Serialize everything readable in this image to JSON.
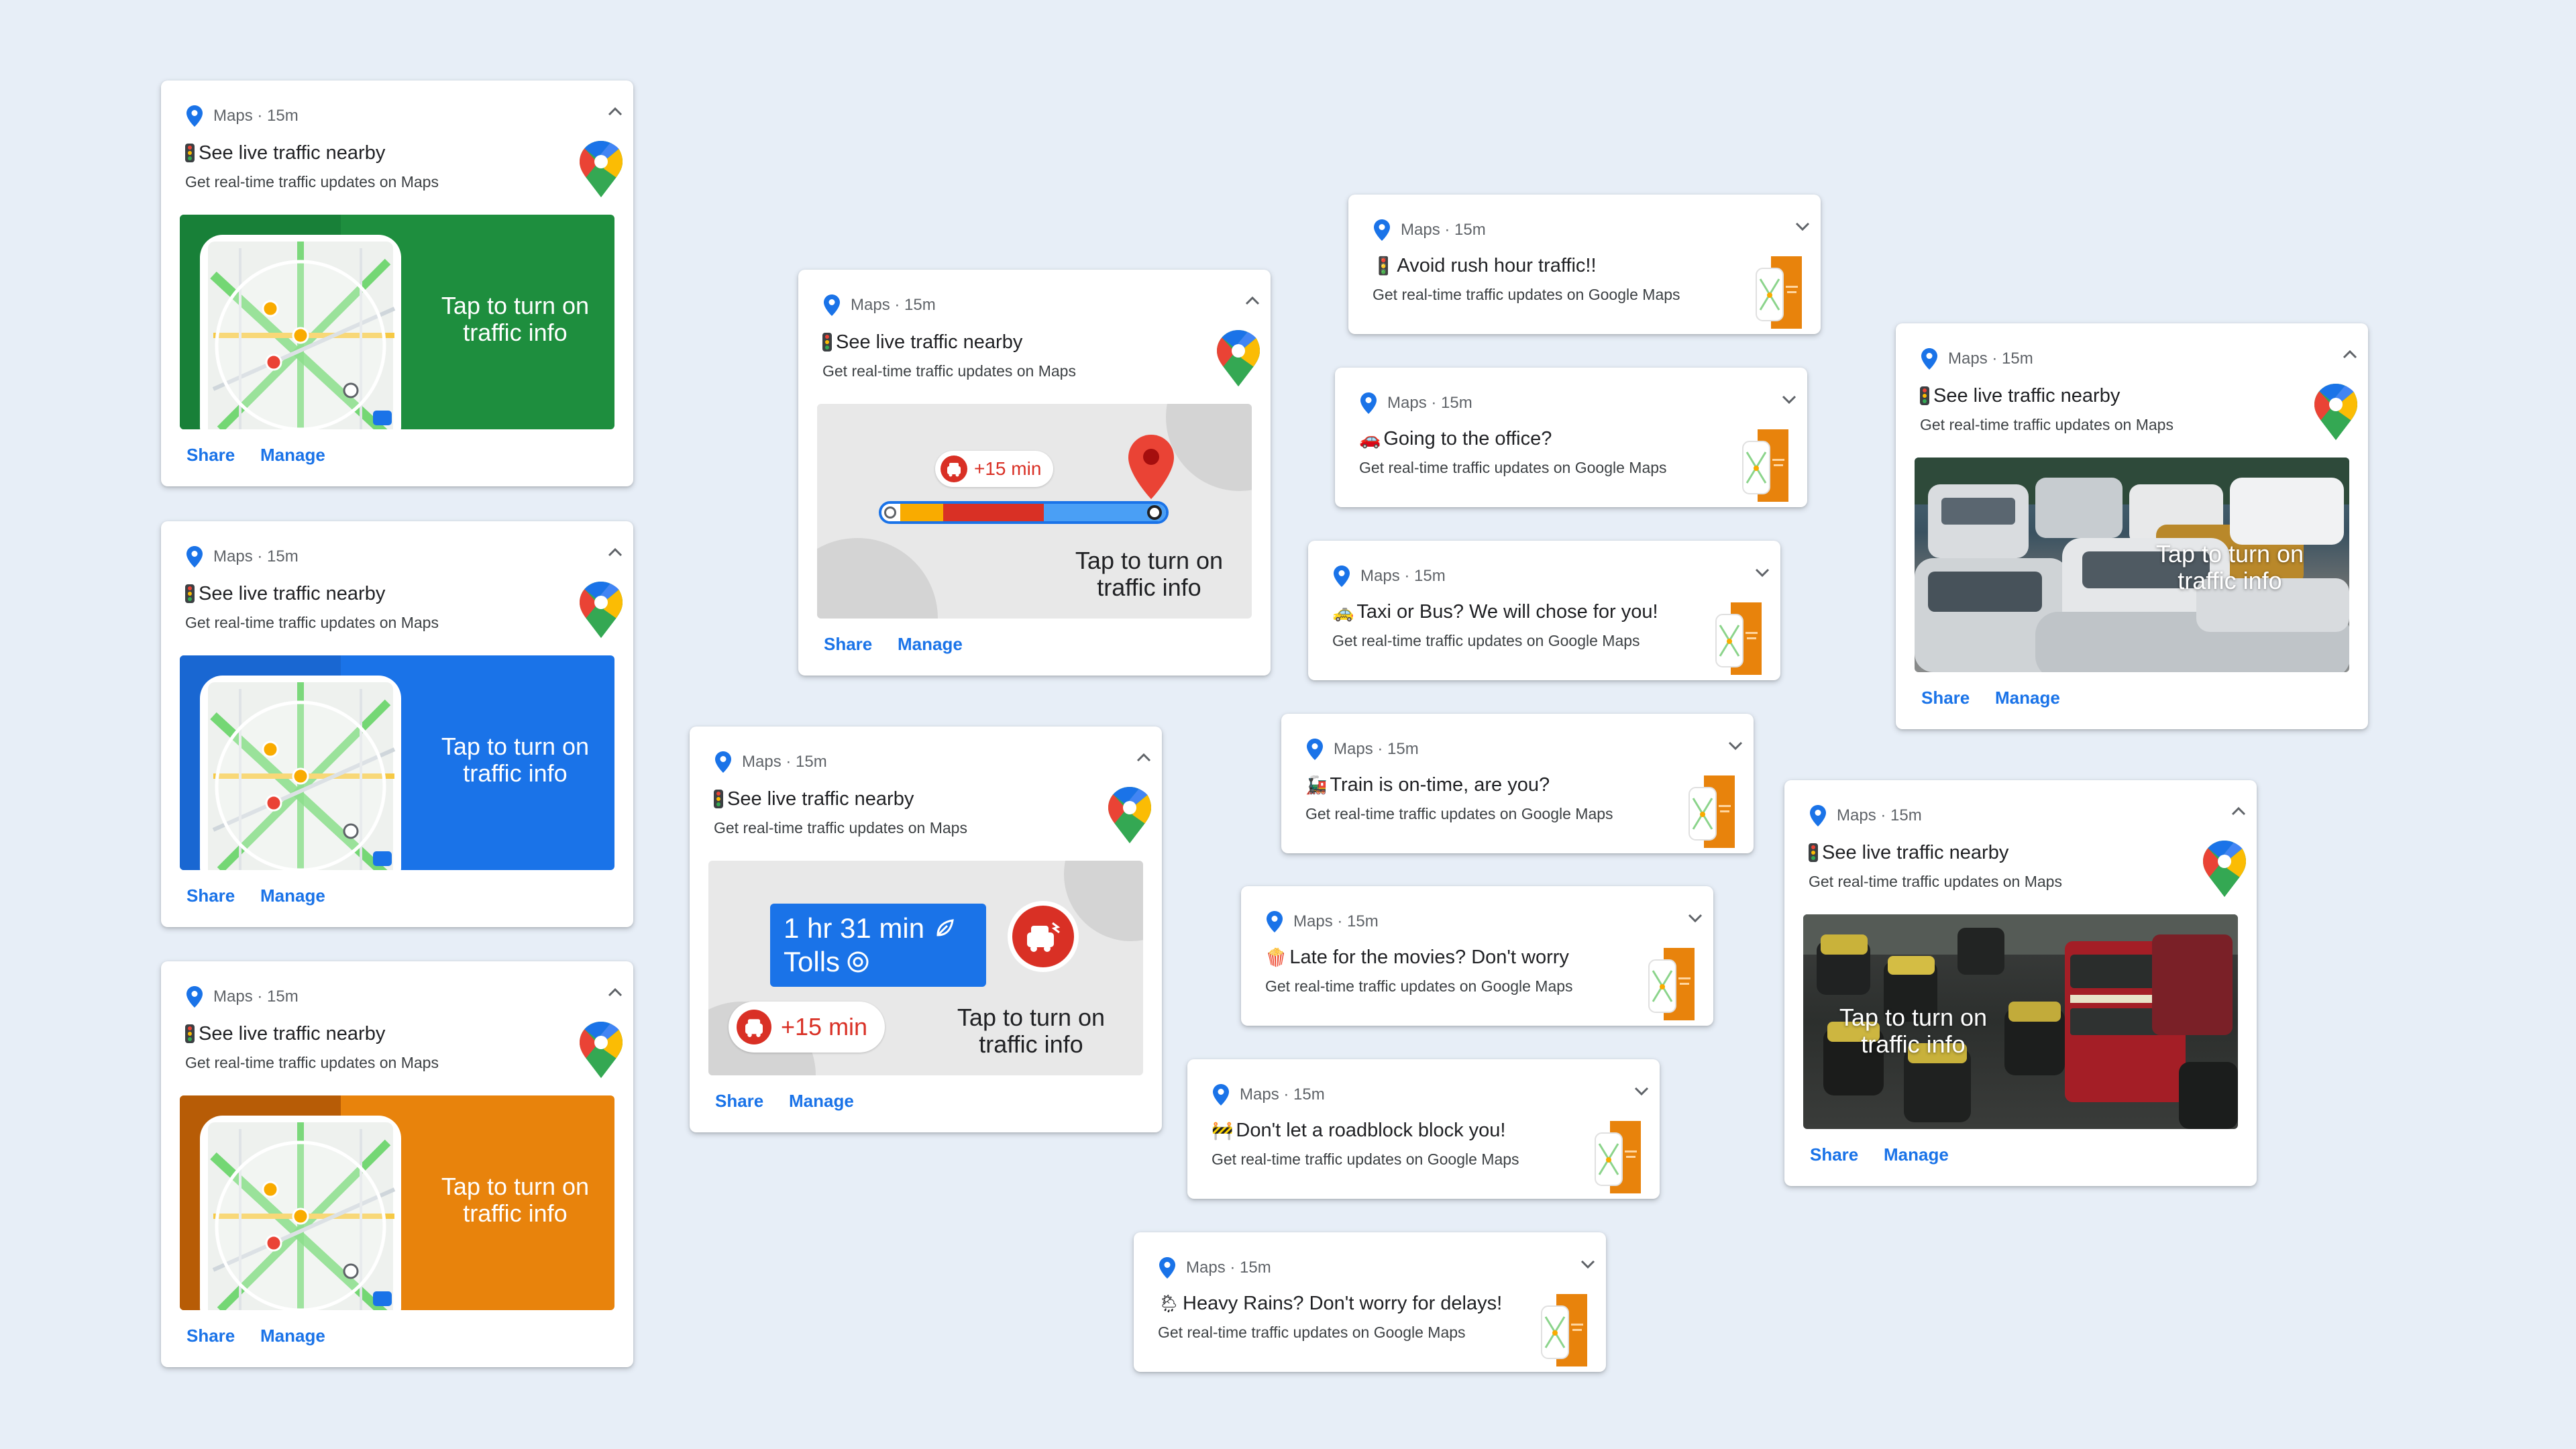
{
  "common": {
    "app_meta": "Maps · 15m",
    "share_label": "Share",
    "manage_label": "Manage"
  },
  "expanded": [
    {
      "title": "See live traffic nearby",
      "subtitle": "Get real-time traffic updates on Maps",
      "hero": "map-green",
      "hero_text_l1": "Tap to turn on",
      "hero_text_l2": "traffic info",
      "accent": "#1e8e3e"
    },
    {
      "title": "See live traffic nearby",
      "subtitle": "Get real-time traffic updates on Maps",
      "hero": "map-blue",
      "hero_text_l1": "Tap to turn on",
      "hero_text_l2": "traffic info",
      "accent": "#1a73e8"
    },
    {
      "title": "See live traffic nearby",
      "subtitle": "Get real-time traffic updates on Maps",
      "hero": "map-orange",
      "hero_text_l1": "Tap to turn on",
      "hero_text_l2": "traffic info",
      "accent": "#e8830c"
    },
    {
      "title": "See live traffic nearby",
      "subtitle": "Get real-time traffic updates on Maps",
      "hero": "route-bar",
      "hero_text_l1": "Tap to turn on",
      "hero_text_l2": "traffic info",
      "delay_badge": "+15 min"
    },
    {
      "title": "See live traffic nearby",
      "subtitle": "Get real-time traffic updates on Maps",
      "hero": "eta-tolls",
      "hero_text_l1": "Tap to turn on",
      "hero_text_l2": "traffic info",
      "eta": "1 hr 31 min",
      "tolls": "Tolls",
      "delay_badge": "+15 min"
    },
    {
      "title": "See live traffic nearby",
      "subtitle": "Get real-time traffic updates on Maps",
      "hero": "photo-cars",
      "hero_text_l1": "Tap to turn on",
      "hero_text_l2": "traffic info"
    },
    {
      "title": "See live traffic nearby",
      "subtitle": "Get real-time traffic updates on Maps",
      "hero": "photo-bus",
      "hero_text_l1": "Tap to turn on",
      "hero_text_l2": "traffic info"
    }
  ],
  "collapsed": [
    {
      "emoji": "🚦",
      "title": "Avoid rush hour traffic!!",
      "subtitle": "Get real-time traffic updates on Google Maps"
    },
    {
      "emoji": "🚗",
      "title": "Going to the office?",
      "subtitle": "Get real-time traffic updates on Google Maps"
    },
    {
      "emoji": "🚕",
      "title": "Taxi or Bus? We will chose for you!",
      "subtitle": "Get real-time traffic updates on Google Maps"
    },
    {
      "emoji": "🚂",
      "title": "Train is on-time, are you?",
      "subtitle": "Get real-time traffic updates on Google Maps"
    },
    {
      "emoji": "🍿",
      "title": "Late for the movies? Don't worry",
      "subtitle": "Get real-time traffic updates on Google Maps"
    },
    {
      "emoji": "🚧",
      "title": "Don't let a roadblock block you!",
      "subtitle": "Get real-time traffic updates on Google Maps"
    },
    {
      "emoji": "🌦",
      "title": "Heavy Rains? Don't worry for delays!",
      "subtitle": "Get real-time traffic updates on Google Maps"
    }
  ],
  "colors": {
    "background": "#e7eef7",
    "link": "#1a73e8",
    "traffic_red": "#d93025",
    "traffic_yellow": "#f9ab00",
    "traffic_blue": "#4a9ff5",
    "eta_blue": "#1a73e8"
  },
  "icons": [
    "maps-pin-icon",
    "google-maps-logo-icon",
    "chevron-up-icon",
    "chevron-down-icon",
    "traffic-light-icon",
    "delay-car-icon",
    "toll-icon",
    "leaf-icon",
    "destination-pin-icon"
  ]
}
